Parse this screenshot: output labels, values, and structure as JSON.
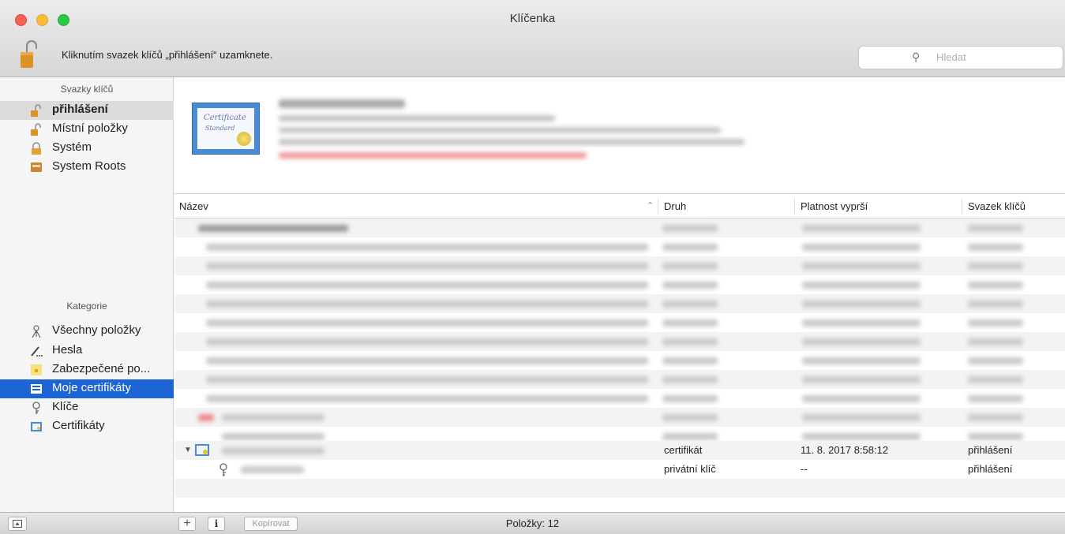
{
  "window": {
    "title": "Klíčenka"
  },
  "toolbar": {
    "lock_message": "Kliknutím svazek klíčů „přihlášení“ uzamknete.",
    "search_placeholder": "Hledat"
  },
  "sidebar": {
    "keychains_header": "Svazky klíčů",
    "keychains": [
      {
        "label": "přihlášení",
        "icon": "lock-open-icon",
        "active": true
      },
      {
        "label": "Místní položky",
        "icon": "lock-open-icon"
      },
      {
        "label": "Systém",
        "icon": "lock-closed-icon"
      },
      {
        "label": "System Roots",
        "icon": "cabinet-icon"
      }
    ],
    "categories_header": "Kategorie",
    "categories": [
      {
        "label": "Všechny položky",
        "icon": "all-items-icon"
      },
      {
        "label": "Hesla",
        "icon": "password-icon"
      },
      {
        "label": "Zabezpečené po...",
        "icon": "secure-note-icon"
      },
      {
        "label": "Moje certifikáty",
        "icon": "my-certificate-icon",
        "selected": true
      },
      {
        "label": "Klíče",
        "icon": "key-icon"
      },
      {
        "label": "Certifikáty",
        "icon": "certificate-icon"
      }
    ]
  },
  "detail": {
    "cert_icon_text": "Certificate",
    "cert_icon_subtext": "Standard"
  },
  "table": {
    "columns": [
      "Název",
      "Druh",
      "Platnost vyprší",
      "Svazek klíčů"
    ],
    "visible_rows": [
      {
        "kind": "certifikát",
        "expires": "11. 8. 2017 8:58:12",
        "keychain": "přihlášení"
      },
      {
        "kind": "privátní klíč",
        "expires": "--",
        "keychain": "přihlášení"
      }
    ]
  },
  "statusbar": {
    "copy_button": "Kopírovat",
    "item_count": "Položky: 12"
  },
  "colors": {
    "selection": "#1d64d6",
    "close": "#fc5f57",
    "minimize": "#fdbc2e",
    "maximize": "#29c940"
  }
}
